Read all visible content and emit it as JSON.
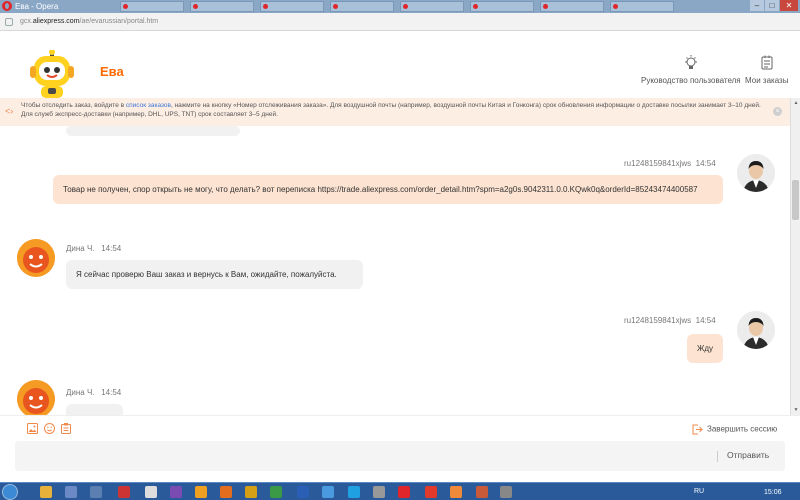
{
  "window": {
    "title": "Ева - Opera",
    "tabs": [
      "",
      "",
      "",
      "",
      "",
      "",
      "",
      "",
      "",
      ""
    ],
    "url_prefix": "gcx.",
    "url_domain": "aliexpress.com",
    "url_path": "/ae/evarussian/portal.htm"
  },
  "header": {
    "agent_name": "Ева",
    "user_guide_label": "Руководство пользователя",
    "my_orders_label": "Мои заказы"
  },
  "notice": {
    "text_before": "Чтобы отследить заказ, войдите в ",
    "link_text": "список заказов",
    "text_after": ", нажмите на кнопку «Номер отслеживания заказа». Для воздушной почты (например, воздушной почты Китая и Гонконга) срок обновления информации о доставке посылки занимает 3–10 дней. Для служб экспресс-доставки (например, DHL, UPS, TNT) срок составляет 3–5 дней."
  },
  "messages": [
    {
      "sender": "ru1248159841xjws",
      "time": "14:54",
      "text": "Товар не получен, спор открыть не могу, что делать? вот переписка https://trade.aliexpress.com/order_detail.htm?spm=a2g0s.9042311.0.0.KQwk0q&orderId=85243474400587"
    },
    {
      "sender": "Дина Ч.",
      "time": "14:54",
      "text": "Я сейчас проверю Ваш заказ и вернусь к Вам, ожидайте, пожалуйста."
    },
    {
      "sender": "ru1248159841xjws",
      "time": "14:54",
      "text": "Жду"
    },
    {
      "sender": "Дина Ч.",
      "time": "14:54",
      "text": ""
    }
  ],
  "composer": {
    "end_session_label": "Завершить сессию",
    "send_label": "Отправить"
  },
  "taskbar": {
    "language": "RU",
    "time": "15:06"
  },
  "colors": {
    "accent": "#ff6a00",
    "user_bubble": "#fde3d1",
    "agent_bubble": "#f1f1f1",
    "notice_bg": "#fdeee4",
    "link": "#3d78d8"
  }
}
